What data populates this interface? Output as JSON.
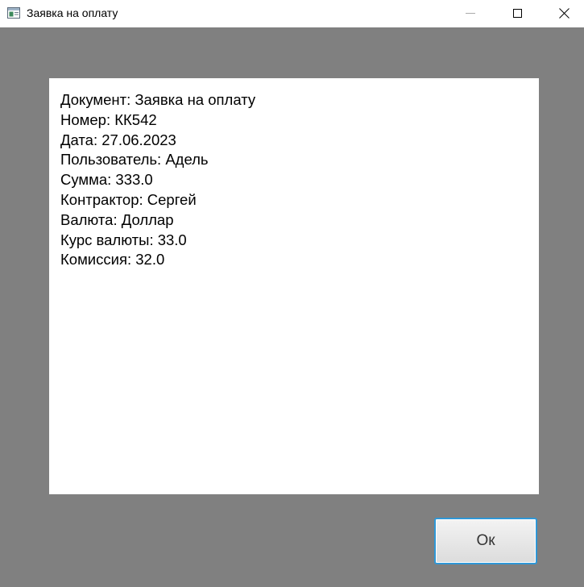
{
  "window": {
    "title": "Заявка на оплату",
    "icon": "app-window-icon",
    "controls": {
      "minimize_icon": "minimize-icon",
      "maximize_icon": "maximize-icon",
      "close_icon": "close-icon"
    },
    "background_color": "#808080"
  },
  "document": {
    "lines": [
      "Документ: Заявка на оплату",
      "Номер: КК542",
      "Дата: 27.06.2023",
      "Пользователь: Адель",
      "Сумма: 333.0",
      "Контрактор: Сергей",
      "Валюта: Доллар",
      "Курс валюты: 33.0",
      "Комиссия: 32.0"
    ]
  },
  "actions": {
    "ok_label": "Ок",
    "ok_border_color": "#2f97d6"
  }
}
